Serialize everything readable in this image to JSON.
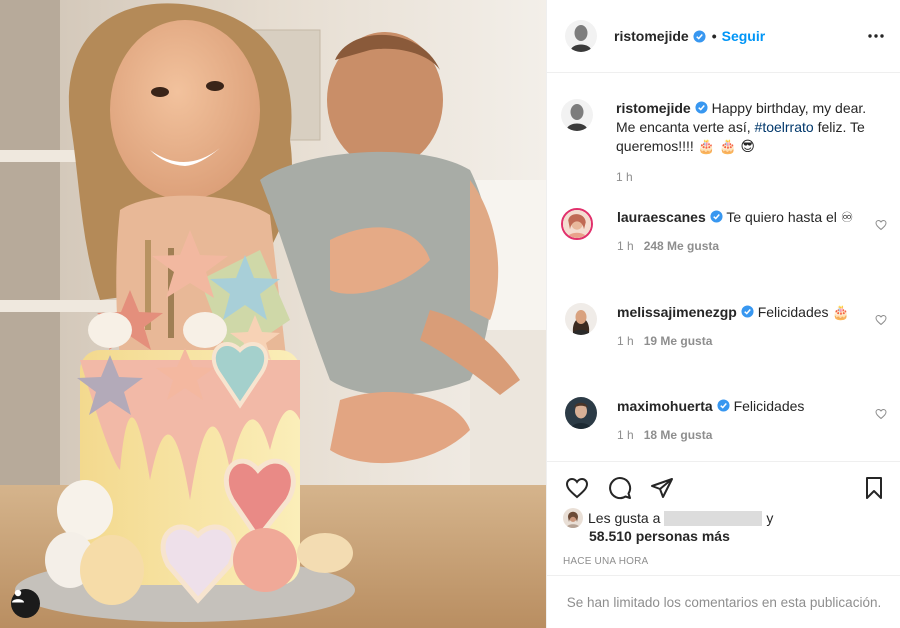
{
  "post": {
    "author": {
      "username": "ristomejide",
      "verified": true
    },
    "follow_label": "Seguir",
    "separator": "•",
    "caption": {
      "username": "ristomejide",
      "text_before": "Happy birthday, my dear. Me encanta verte así, ",
      "hashtag": "#toelrrato",
      "text_after": " feliz. Te queremos!!!! 🎂 🎂 😎",
      "time": "1 h"
    },
    "comments": [
      {
        "username": "lauraescanes",
        "verified": true,
        "text": "Te quiero hasta el ♾",
        "time": "1 h",
        "likes": "248 Me gusta"
      },
      {
        "username": "melissajimenezgp",
        "verified": true,
        "text": "Felicidades 🎂",
        "time": "1 h",
        "likes": "19 Me gusta"
      },
      {
        "username": "maximohuerta",
        "verified": true,
        "text": "Felicidades",
        "time": "1 h",
        "likes": "18 Me gusta"
      }
    ],
    "liked_by": {
      "prefix": "Les gusta a",
      "suffix": "y",
      "count_text": "58.510 personas más"
    },
    "time_ago": "HACE UNA HORA",
    "comments_limited": "Se han limitado los comentarios en esta publicación."
  },
  "icons": {
    "more": "more-options-icon",
    "like": "heart-icon",
    "comment": "comment-icon",
    "share": "paper-plane-icon",
    "save": "bookmark-icon",
    "tag": "person-tag-icon",
    "verified": "verified-badge-icon"
  },
  "colors": {
    "accent": "#0095f6",
    "verified": "#3897f0",
    "muted": "#8e8e8e",
    "hashtag": "#00376b"
  }
}
